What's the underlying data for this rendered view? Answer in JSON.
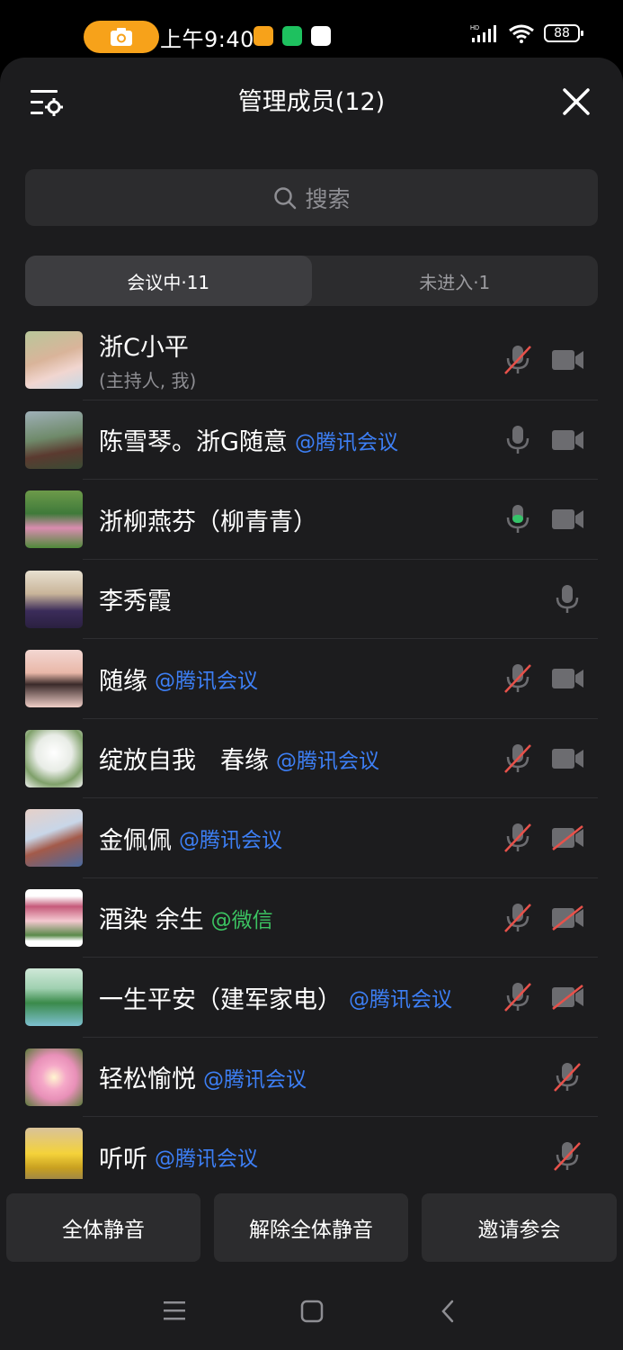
{
  "status_bar": {
    "time": "上午9:40",
    "battery": "88"
  },
  "header": {
    "title": "管理成员(12)"
  },
  "search": {
    "placeholder": "搜索"
  },
  "tabs": [
    {
      "label": "会议中·11",
      "active": true
    },
    {
      "label": "未进入·1",
      "active": false
    }
  ],
  "members": [
    {
      "name": "浙C小平",
      "subtitle": "(主持人, 我)",
      "source": "",
      "mic": "muted",
      "camera": "on"
    },
    {
      "name": "陈雪琴。浙G随意",
      "subtitle": "",
      "source": "@腾讯会议",
      "mic": "on",
      "camera": "on"
    },
    {
      "name": "浙柳燕芬（柳青青）",
      "subtitle": "",
      "source": "",
      "mic": "speaking",
      "camera": "on"
    },
    {
      "name": "李秀霞",
      "subtitle": "",
      "source": "",
      "mic": "on",
      "camera": "none"
    },
    {
      "name": "随缘",
      "subtitle": "",
      "source": "@腾讯会议",
      "mic": "muted",
      "camera": "on"
    },
    {
      "name": "绽放自我　春缘",
      "subtitle": "",
      "source": "@腾讯会议",
      "mic": "muted",
      "camera": "on"
    },
    {
      "name": "金佩佩",
      "subtitle": "",
      "source": "@腾讯会议",
      "mic": "muted",
      "camera": "off"
    },
    {
      "name": "酒染  余生",
      "subtitle": "",
      "source": "@微信",
      "mic": "muted",
      "camera": "off"
    },
    {
      "name": "一生平安（建军家电）",
      "subtitle": "",
      "source": "@腾讯会议",
      "mic": "muted",
      "camera": "off"
    },
    {
      "name": "轻松愉悦",
      "subtitle": "",
      "source": "@腾讯会议",
      "mic": "muted",
      "camera": "none"
    },
    {
      "name": "听听",
      "subtitle": "",
      "source": "@腾讯会议",
      "mic": "muted",
      "camera": "none"
    }
  ],
  "actions": {
    "mute_all": "全体静音",
    "unmute_all": "解除全体静音",
    "invite": "邀请参会"
  },
  "colors": {
    "accent_blue": "#3d7ff5",
    "wechat_green": "#3cc462",
    "muted_red": "#e8514a",
    "speaking_green": "#36c46a"
  }
}
